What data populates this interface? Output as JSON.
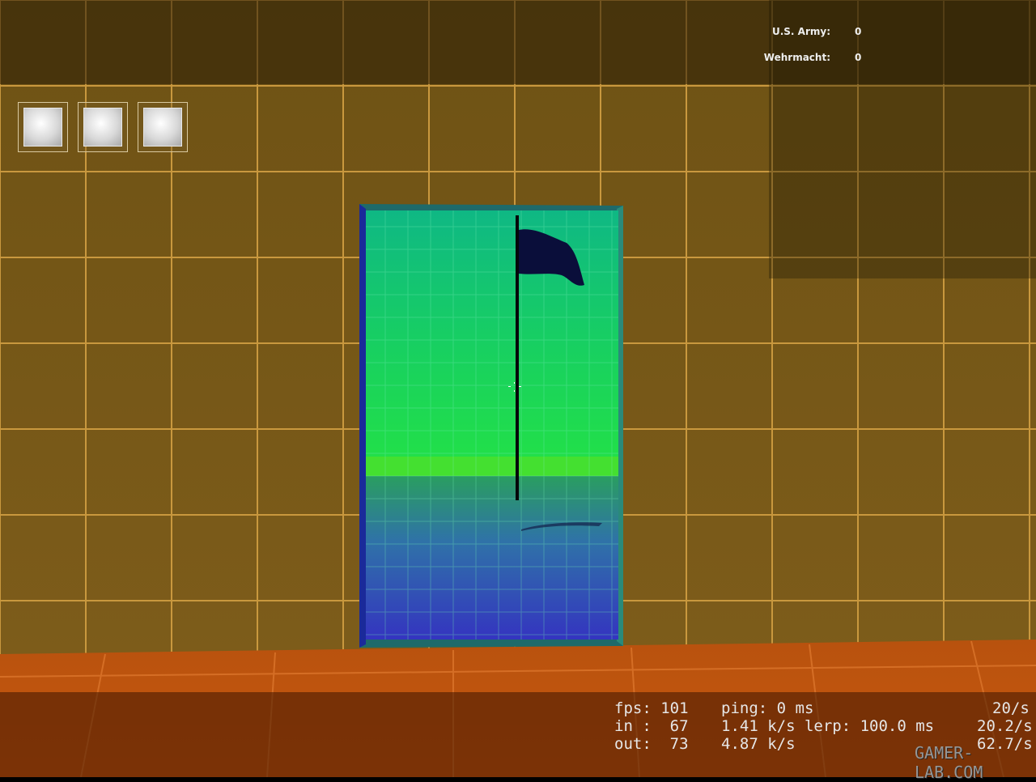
{
  "scoreboard": {
    "teams": [
      {
        "name": "U.S. Army:",
        "score": "0"
      },
      {
        "name": "Wehrmacht:",
        "score": "0"
      }
    ]
  },
  "inventory": {
    "slots": [
      "empty",
      "empty",
      "empty"
    ]
  },
  "netgraph": {
    "row1": {
      "fps": "fps: 101",
      "ping": "ping: 0 ms",
      "rate": "20/s"
    },
    "row2": {
      "in": "in :  67",
      "stats": "1.41 k/s lerp: 100.0 ms",
      "rate": "20.2/s"
    },
    "row3": {
      "out": "out:  73",
      "stats": "4.87 k/s",
      "rate": "62.7/s"
    }
  },
  "watermark": "GAMER-LAB.COM",
  "colors": {
    "wall": "#7a5a18",
    "floor": "#c0530f",
    "grid": "#c79a4a",
    "portal_top": "#10c870",
    "portal_bottom": "#3a3ac8"
  }
}
